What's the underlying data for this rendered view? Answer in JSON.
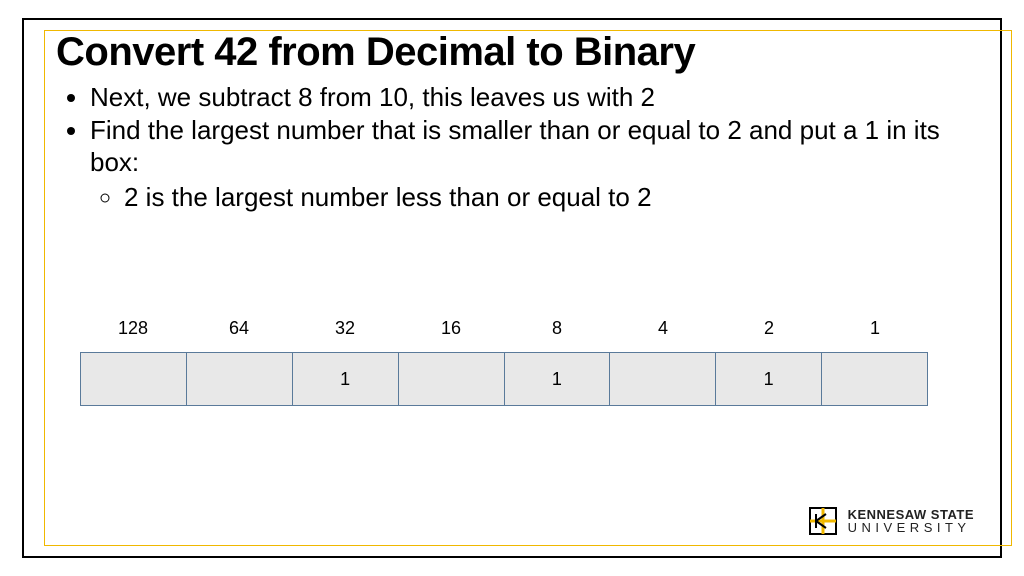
{
  "title": "Convert 42 from Decimal to Binary",
  "bullets": {
    "b1": "Next, we subtract 8 from 10, this leaves us with 2",
    "b2": "Find the largest number that is smaller than or equal to 2 and put a 1 in its box:",
    "b2_sub": "2 is the largest number less than or equal to 2"
  },
  "table": {
    "labels": [
      "128",
      "64",
      "32",
      "16",
      "8",
      "4",
      "2",
      "1"
    ],
    "values": [
      "",
      "",
      "1",
      "",
      "1",
      "",
      "1",
      ""
    ]
  },
  "logo": {
    "line1": "KENNESAW STATE",
    "line2": "UNIVERSITY"
  }
}
